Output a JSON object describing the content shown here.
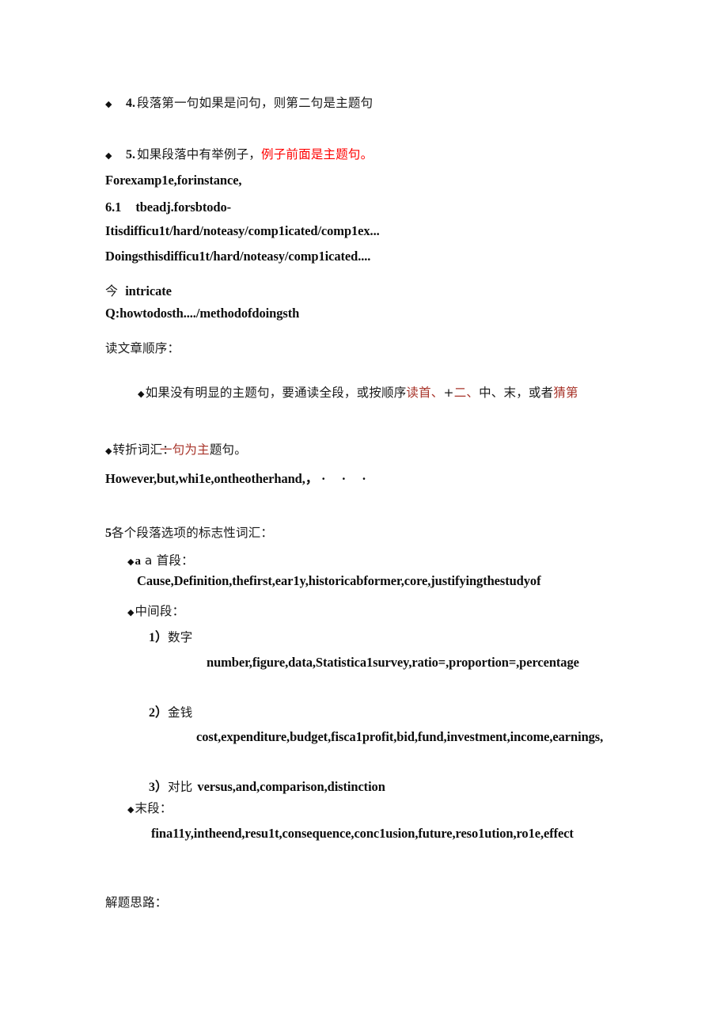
{
  "document": {
    "page_type": "study-notes-scan",
    "language": "zh-CN + en",
    "colors": {
      "text": "#111111",
      "accent_red": "#ff0000",
      "muted_red": "#a8342a",
      "background": "#ffffff"
    }
  },
  "content": {
    "item4": {
      "bullet": "diamond-bullet",
      "number": "4.",
      "text": "段落第一句如果是问句，则第二句是主题句"
    },
    "item5": {
      "bullet": "diamond-bullet",
      "number": "5.",
      "text_black": "如果段落中有举例子，",
      "text_red": "例子前面是主题句。"
    },
    "example_lines": {
      "line1": "Forexamp1e,forinstance,",
      "line2_num": "6.1",
      "line2_text": "tbeadj.forsbtodo-",
      "line3": "Itisdifficu1t/hard/noteasy/comp1icated/comp1ex...",
      "line4": "Doingsthisdifficu1t/hard/noteasy/comp1icated...."
    },
    "intricate": {
      "marker": "今",
      "word": "intricate"
    },
    "question_line": "Q:howtodosth..../methodofdoingsth",
    "reading_order": {
      "heading": "读文章顺序：",
      "bullet": "diamond-bullet",
      "seg1_black": "如果没有明显的主题句，要通读全段，或按顺序",
      "seg2_red": "读首、",
      "seg3_black": "+",
      "seg4_red": "二、",
      "seg5_black": "中、末，或者",
      "seg6_red": "猜第",
      "seg7_red_line2": "一句为主",
      "seg8_black_line2": "题句。"
    },
    "transition": {
      "bullet": "diamond-bullet",
      "heading": "转折词汇：",
      "words": "However,but,whi1e,ontheotherhand,，",
      "dots": "· · ·"
    },
    "section5": {
      "number": "5",
      "heading": "各个段落选项的标志性词汇：",
      "first_para": {
        "bullet": "diamond-bullet",
        "label": "a 首段：",
        "words": "Cause,Definition,thefirst,ear1y,historicabformer,core,justifyingthestudyof"
      },
      "middle_para": {
        "bullet": "diamond-bullet",
        "label": "中间段：",
        "sub1": {
          "number": "1）",
          "label": "数字",
          "words": "number,figure,data,Statistica1survey,ratio=,proportion=,percentage"
        },
        "sub2": {
          "number": "2）",
          "label": "金钱",
          "words": "cost,expenditure,budget,fisca1profit,bid,fund,investment,income,earnings,"
        },
        "sub3": {
          "number": "3）",
          "label": "对比",
          "words": "versus,and,comparison,distinction"
        }
      },
      "last_para": {
        "bullet": "diamond-bullet",
        "label": "末段：",
        "words": "fina11y,intheend,resu1t,consequence,conc1usion,future,reso1ution,ro1e,effect"
      }
    },
    "footer_heading": "解题思路："
  }
}
